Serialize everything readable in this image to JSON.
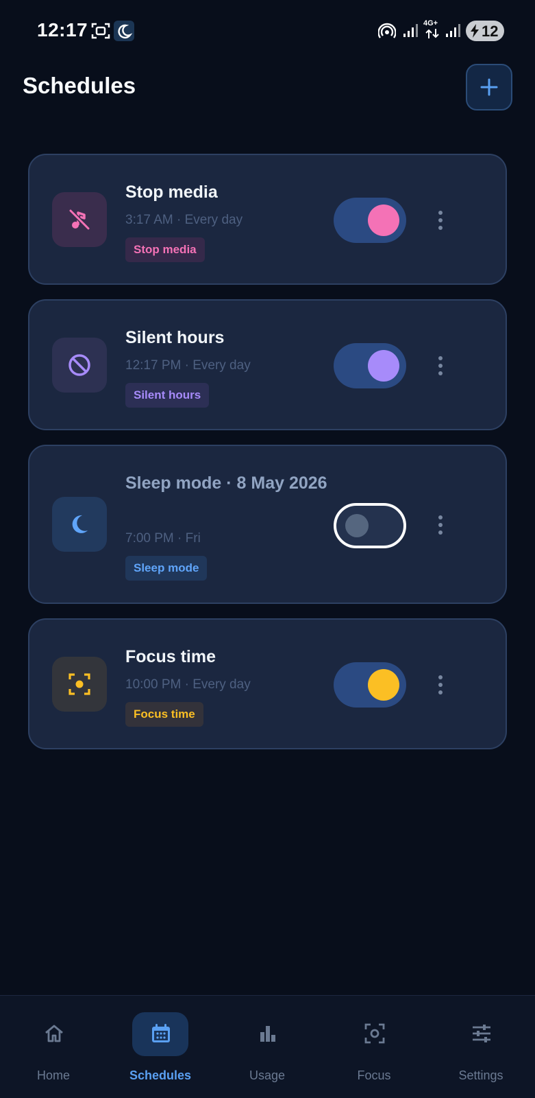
{
  "status_bar": {
    "time": "12:17",
    "network": "4G+",
    "battery": "12"
  },
  "header": {
    "title": "Schedules",
    "add_icon": "plus-icon"
  },
  "schedules": [
    {
      "title": "Stop media",
      "subtitle": "3:17 AM · Every day",
      "tag": "Stop media",
      "icon": "music-off-icon",
      "enabled": true,
      "accent": "#f472b6",
      "tile_bg": "#3a2d4d",
      "tag_bg": "#35294a"
    },
    {
      "title": "Silent hours",
      "subtitle": "12:17 PM · Every day",
      "tag": "Silent hours",
      "icon": "block-icon",
      "enabled": true,
      "accent": "#a78bfa",
      "tile_bg": "#2d3152",
      "tag_bg": "#2c2f55"
    },
    {
      "title": "Sleep mode · 8 May 2026",
      "subtitle": "7:00 PM · Fri",
      "tag": "Sleep mode",
      "icon": "moon-icon",
      "enabled": false,
      "accent": "#60a5fa",
      "tile_bg": "#223a5e",
      "tag_bg": "#20375a"
    },
    {
      "title": "Focus time",
      "subtitle": "10:00 PM · Every day",
      "tag": "Focus time",
      "icon": "focus-center-icon",
      "enabled": true,
      "accent": "#fbbf24",
      "tile_bg": "#33353b",
      "tag_bg": "#33323a"
    }
  ],
  "bottom_nav": [
    {
      "label": "Home",
      "icon": "home-icon",
      "active": false
    },
    {
      "label": "Schedules",
      "icon": "calendar-icon",
      "active": true
    },
    {
      "label": "Usage",
      "icon": "bar-chart-icon",
      "active": false
    },
    {
      "label": "Focus",
      "icon": "focus-frame-icon",
      "active": false
    },
    {
      "label": "Settings",
      "icon": "sliders-icon",
      "active": false
    }
  ]
}
